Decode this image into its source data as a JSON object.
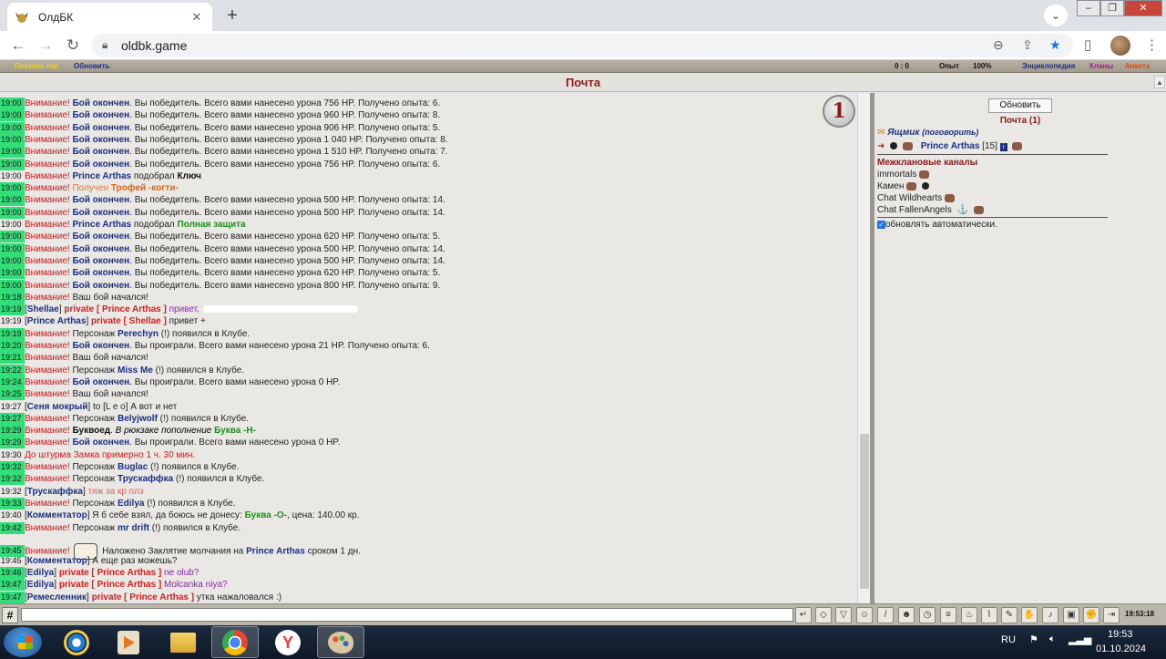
{
  "browser": {
    "tab_title": "ОлдБК",
    "url": "oldbk.game"
  },
  "game_top": {
    "left1": "Покупка екр",
    "left2": "Обновить",
    "stats": "0 : 0",
    "exp": "Опыт",
    "percent": "100%",
    "link1": "Энциклопедия",
    "link2": "Кланы",
    "link3": "Анкета"
  },
  "page_title": "Почта",
  "badge": "1",
  "chat": [
    {
      "t": "19:00",
      "h": true,
      "parts": [
        [
          "red",
          "Внимание! "
        ],
        [
          "bb",
          "Бой окончен"
        ],
        [
          "txt",
          ". Вы победитель. Всего вами нанесено урона 756 HP. Получено опыта: 6."
        ]
      ]
    },
    {
      "t": "19:00",
      "h": true,
      "parts": [
        [
          "red",
          "Внимание! "
        ],
        [
          "bb",
          "Бой окончен"
        ],
        [
          "txt",
          ". Вы победитель. Всего вами нанесено урона 960 HP. Получено опыта: 8."
        ]
      ]
    },
    {
      "t": "19:00",
      "h": true,
      "parts": [
        [
          "red",
          "Внимание! "
        ],
        [
          "bb",
          "Бой окончен"
        ],
        [
          "txt",
          ". Вы победитель. Всего вами нанесено урона 906 HP. Получено опыта: 5."
        ]
      ]
    },
    {
      "t": "19:00",
      "h": true,
      "parts": [
        [
          "red",
          "Внимание! "
        ],
        [
          "bb",
          "Бой окончен"
        ],
        [
          "txt",
          ". Вы победитель. Всего вами нанесено урона 1 040 HP. Получено опыта: 8."
        ]
      ]
    },
    {
      "t": "19:00",
      "h": true,
      "parts": [
        [
          "red",
          "Внимание! "
        ],
        [
          "bb",
          "Бой окончен"
        ],
        [
          "txt",
          ". Вы победитель. Всего вами нанесено урона 1 510 HP. Получено опыта: 7."
        ]
      ]
    },
    {
      "t": "19:00",
      "h": true,
      "parts": [
        [
          "red",
          "Внимание! "
        ],
        [
          "bb",
          "Бой окончен"
        ],
        [
          "txt",
          ". Вы победитель. Всего вами нанесено урона 756 HP. Получено опыта: 6."
        ]
      ]
    },
    {
      "t": "19:00",
      "h": false,
      "parts": [
        [
          "red",
          "Внимание! "
        ],
        [
          "bb",
          "Prince Arthas"
        ],
        [
          "txt",
          " подобрал "
        ],
        [
          "bold",
          "Ключ"
        ]
      ]
    },
    {
      "t": "19:00",
      "h": true,
      "parts": [
        [
          "red",
          "Внимание! "
        ],
        [
          "orange",
          "Получен "
        ],
        [
          "org-b",
          "Трофей -когти-"
        ]
      ]
    },
    {
      "t": "19:00",
      "h": true,
      "parts": [
        [
          "red",
          "Внимание! "
        ],
        [
          "bb",
          "Бой окончен"
        ],
        [
          "txt",
          ". Вы победитель. Всего вами нанесено урона 500 HP. Получено опыта: 14."
        ]
      ]
    },
    {
      "t": "19:00",
      "h": true,
      "parts": [
        [
          "red",
          "Внимание! "
        ],
        [
          "bb",
          "Бой окончен"
        ],
        [
          "txt",
          ". Вы победитель. Всего вами нанесено урона 500 HP. Получено опыта: 14."
        ]
      ]
    },
    {
      "t": "19:00",
      "h": false,
      "parts": [
        [
          "red",
          "Внимание! "
        ],
        [
          "bb",
          "Prince Arthas"
        ],
        [
          "txt",
          " подобрал "
        ],
        [
          "green",
          "Полная защита"
        ]
      ]
    },
    {
      "t": "19:00",
      "h": true,
      "parts": [
        [
          "red",
          "Внимание! "
        ],
        [
          "bb",
          "Бой окончен"
        ],
        [
          "txt",
          ". Вы победитель. Всего вами нанесено урона 620 HP. Получено опыта: 5."
        ]
      ]
    },
    {
      "t": "19:00",
      "h": true,
      "parts": [
        [
          "red",
          "Внимание! "
        ],
        [
          "bb",
          "Бой окончен"
        ],
        [
          "txt",
          ". Вы победитель. Всего вами нанесено урона 500 HP. Получено опыта: 14."
        ]
      ]
    },
    {
      "t": "19:00",
      "h": true,
      "parts": [
        [
          "red",
          "Внимание! "
        ],
        [
          "bb",
          "Бой окончен"
        ],
        [
          "txt",
          ". Вы победитель. Всего вами нанесено урона 500 HP. Получено опыта: 14."
        ]
      ]
    },
    {
      "t": "19:00",
      "h": true,
      "parts": [
        [
          "red",
          "Внимание! "
        ],
        [
          "bb",
          "Бой окончен"
        ],
        [
          "txt",
          ". Вы победитель. Всего вами нанесено урона 620 HP. Получено опыта: 5."
        ]
      ]
    },
    {
      "t": "19:00",
      "h": true,
      "parts": [
        [
          "red",
          "Внимание! "
        ],
        [
          "bb",
          "Бой окончен"
        ],
        [
          "txt",
          ". Вы победитель. Всего вами нанесено урона 800 HP. Получено опыта: 9."
        ]
      ]
    },
    {
      "t": "19:18",
      "h": true,
      "parts": [
        [
          "red",
          "Внимание! "
        ],
        [
          "txt",
          "Ваш бой начался!"
        ]
      ]
    },
    {
      "t": "19:19",
      "h": true,
      "blur": true,
      "parts": [
        [
          "txt",
          "["
        ],
        [
          "name",
          "Shellae"
        ],
        [
          "txt",
          "] "
        ],
        [
          "priv",
          "private [ Prince Arthas ]"
        ],
        [
          "purple",
          " привет,"
        ]
      ]
    },
    {
      "t": "19:19",
      "h": false,
      "parts": [
        [
          "txt",
          "["
        ],
        [
          "name",
          "Prince Arthas"
        ],
        [
          "txt",
          "] "
        ],
        [
          "priv",
          "private [ Shellae ]"
        ],
        [
          "txt",
          " привет +"
        ]
      ]
    },
    {
      "t": "19:19",
      "h": true,
      "parts": [
        [
          "red",
          "Внимание! "
        ],
        [
          "txt",
          "Персонаж "
        ],
        [
          "bb",
          "Perechyn"
        ],
        [
          "txt",
          " (!) появился в Клубе."
        ]
      ]
    },
    {
      "t": "19:20",
      "h": true,
      "parts": [
        [
          "red",
          "Внимание! "
        ],
        [
          "bb",
          "Бой окончен"
        ],
        [
          "txt",
          ". Вы проиграли. Всего вами нанесено урона 21 HP. Получено опыта: 6."
        ]
      ]
    },
    {
      "t": "19:21",
      "h": true,
      "parts": [
        [
          "red",
          "Внимание! "
        ],
        [
          "txt",
          "Ваш бой начался!"
        ]
      ]
    },
    {
      "t": "19:22",
      "h": true,
      "parts": [
        [
          "red",
          "Внимание! "
        ],
        [
          "txt",
          "Персонаж "
        ],
        [
          "bb",
          "Miss Me"
        ],
        [
          "txt",
          " (!) появился в Клубе."
        ]
      ]
    },
    {
      "t": "19:24",
      "h": true,
      "parts": [
        [
          "red",
          "Внимание! "
        ],
        [
          "bb",
          "Бой окончен"
        ],
        [
          "txt",
          ". Вы проиграли. Всего вами нанесено урона 0 HP."
        ]
      ]
    },
    {
      "t": "19:25",
      "h": true,
      "parts": [
        [
          "red",
          "Внимание! "
        ],
        [
          "txt",
          "Ваш бой начался!"
        ]
      ]
    },
    {
      "t": "19:27",
      "h": false,
      "parts": [
        [
          "txt",
          "["
        ],
        [
          "name",
          "Сеня мокрый"
        ],
        [
          "txt",
          "] to [L e o] А вот и нет"
        ]
      ]
    },
    {
      "t": "19:27",
      "h": true,
      "parts": [
        [
          "red",
          "Внимание! "
        ],
        [
          "txt",
          "Персонаж "
        ],
        [
          "bb",
          "Belyjwolf"
        ],
        [
          "txt",
          " (!) появился в Клубе."
        ]
      ]
    },
    {
      "t": "19:29",
      "h": true,
      "parts": [
        [
          "red",
          "Внимание! "
        ],
        [
          "bold",
          "Буквоед"
        ],
        [
          "txt",
          ". "
        ],
        [
          "ital",
          "В рюкзаке пополнение "
        ],
        [
          "green",
          "Буква -Н-"
        ]
      ]
    },
    {
      "t": "19:29",
      "h": true,
      "parts": [
        [
          "red",
          "Внимание! "
        ],
        [
          "bb",
          "Бой окончен"
        ],
        [
          "txt",
          ". Вы проиграли. Всего вами нанесено урона 0 HP."
        ]
      ]
    },
    {
      "t": "19:30",
      "h": false,
      "parts": [
        [
          "red",
          "До штурма Замка примерно 1 ч. 30 мин."
        ]
      ]
    },
    {
      "t": "19:32",
      "h": true,
      "parts": [
        [
          "red",
          "Внимание! "
        ],
        [
          "txt",
          "Персонаж "
        ],
        [
          "bb",
          "Buglac"
        ],
        [
          "txt",
          " (!) появился в Клубе."
        ]
      ]
    },
    {
      "t": "19:32",
      "h": true,
      "parts": [
        [
          "red",
          "Внимание! "
        ],
        [
          "txt",
          "Персонаж "
        ],
        [
          "bb",
          "Трускаффка"
        ],
        [
          "txt",
          " (!) появился в Клубе."
        ]
      ]
    },
    {
      "t": "19:32",
      "h": false,
      "parts": [
        [
          "txt",
          "["
        ],
        [
          "name",
          "Трускаффка"
        ],
        [
          "txt",
          "] "
        ],
        [
          "salmon",
          "тяж за кр плз"
        ]
      ]
    },
    {
      "t": "19:33",
      "h": true,
      "parts": [
        [
          "red",
          "Внимание! "
        ],
        [
          "txt",
          "Персонаж "
        ],
        [
          "bb",
          "Edilya"
        ],
        [
          "txt",
          " (!) появился в Клубе."
        ]
      ]
    },
    {
      "t": "19:40",
      "h": false,
      "parts": [
        [
          "txt",
          "["
        ],
        [
          "name",
          "Комментатор"
        ],
        [
          "txt",
          "] Я б себе взял, да боюсь не донесу: "
        ],
        [
          "green",
          "Буква -О-"
        ],
        [
          "txt",
          ", цена: 140.00 кр."
        ]
      ]
    },
    {
      "t": "19:42",
      "h": true,
      "parts": [
        [
          "red",
          "Внимание! "
        ],
        [
          "txt",
          "Персонаж "
        ],
        [
          "bb",
          "mr drift"
        ],
        [
          "txt",
          " (!) появился в Клубе."
        ]
      ]
    },
    {
      "t": "19:45",
      "h": true,
      "scroll": true,
      "parts": [
        [
          "red",
          "Внимание! "
        ],
        [
          "txt",
          " Наложено Заклятие молчания на "
        ],
        [
          "bb",
          "Prince Arthas"
        ],
        [
          "txt",
          " сроком 1 дн."
        ]
      ]
    },
    {
      "t": "19:45",
      "h": false,
      "parts": [
        [
          "txt",
          "["
        ],
        [
          "name",
          "Комментатор"
        ],
        [
          "txt",
          "] А еще раз можешь?"
        ]
      ]
    },
    {
      "t": "19:46",
      "h": true,
      "parts": [
        [
          "txt",
          "["
        ],
        [
          "name",
          "Edilya"
        ],
        [
          "txt",
          "] "
        ],
        [
          "priv",
          "private [ Prince Arthas ]"
        ],
        [
          "purple",
          " ne olub?"
        ]
      ]
    },
    {
      "t": "19:47",
      "h": true,
      "parts": [
        [
          "txt",
          "["
        ],
        [
          "name",
          "Edilya"
        ],
        [
          "txt",
          "] "
        ],
        [
          "priv",
          "private [ Prince Arthas ]"
        ],
        [
          "purple",
          " Molcanka niya?"
        ]
      ]
    },
    {
      "t": "19:47",
      "h": true,
      "parts": [
        [
          "txt",
          "["
        ],
        [
          "name",
          "Ремесленник"
        ],
        [
          "txt",
          "] "
        ],
        [
          "priv",
          "private [ Prince Arthas ]"
        ],
        [
          "txt",
          " утка нажаловался :)"
        ]
      ]
    }
  ],
  "right": {
    "refresh": "Обновить",
    "title": "Почта (1)",
    "box_name": "Ящмик",
    "box_talk": "(поговорить)",
    "player": "Prince Arthas",
    "player_level": "[15]",
    "section": "Межклановые каналы",
    "channels": [
      "immortals",
      "Камен",
      "Chat Wildhearts",
      "Chat FallenAngels"
    ],
    "auto": "обновлять автоматически."
  },
  "bottom": {
    "hash": "#",
    "clock": "19:53:18"
  },
  "tray": {
    "lang": "RU",
    "time": "19:53",
    "date": "01.10.2024"
  }
}
